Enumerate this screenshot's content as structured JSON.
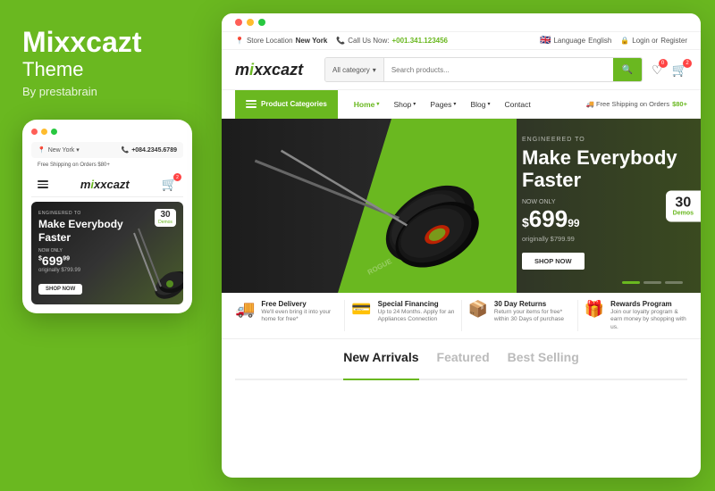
{
  "left": {
    "brand": "Mixxcazt",
    "theme": "Theme",
    "by": "By prestabrain",
    "mobile": {
      "location_label": "New York",
      "location_prefix": "Store Location",
      "phone": "+084.2345.6789",
      "free_shipping": "Free Shipping on Orders $80+",
      "logo": "mixxcazt",
      "hero": {
        "tag": "ENGINEERED TO",
        "title": "Make Everybody Faster",
        "now_only": "NOW ONLY",
        "price_dollar": "$",
        "price_main": "699",
        "price_cents": "99",
        "originally": "originally $799.99",
        "cta": "SHOP NOW",
        "demos_num": "30",
        "demos_label": "Demos"
      }
    }
  },
  "desktop": {
    "dots": [
      "red",
      "yellow",
      "green"
    ],
    "topbar": {
      "store_location_label": "Store Location",
      "store_location_value": "New York",
      "call_us_label": "Call Us Now:",
      "phone": "+001.341.123456",
      "language_label": "Language",
      "language_value": "English",
      "login_label": "Login or",
      "register_label": "Register"
    },
    "logo": "mixxcazt",
    "search": {
      "category_placeholder": "All category",
      "input_placeholder": "Search products...",
      "btn_icon": "🔍"
    },
    "nav": {
      "categories_btn": "Product Categories",
      "links": [
        "Home",
        "Shop",
        "Pages",
        "Blog",
        "Contact"
      ],
      "shipping": "Free Shipping on Orders $80+"
    },
    "hero": {
      "tag": "ENGINEERED TO",
      "title_line1": "Make Everybody",
      "title_line2": "Faster",
      "now_only": "NOW ONLY",
      "price_dollar": "$",
      "price_main": "699",
      "price_cents": "99",
      "originally": "originally $799.99",
      "cta": "SHOP NOW",
      "demos_num": "30",
      "demos_label": "Demos"
    },
    "features": [
      {
        "icon": "🚚",
        "title": "Free Delivery",
        "desc": "We'll even bring it into your home for free*"
      },
      {
        "icon": "💳",
        "title": "Special Financing",
        "desc": "Up to 24 Months. Apply for an Appliances Connection"
      },
      {
        "icon": "📦",
        "title": "30 Day Returns",
        "desc": "Return your items for free* within 30 Days of purchase"
      },
      {
        "icon": "🎁",
        "title": "Rewards Program",
        "desc": "Join our loyalty program & earn money by shopping with us."
      }
    ],
    "tabs": [
      {
        "label": "New Arrivals",
        "active": true
      },
      {
        "label": "Featured",
        "active": false
      },
      {
        "label": "Best Selling",
        "active": false
      }
    ]
  }
}
